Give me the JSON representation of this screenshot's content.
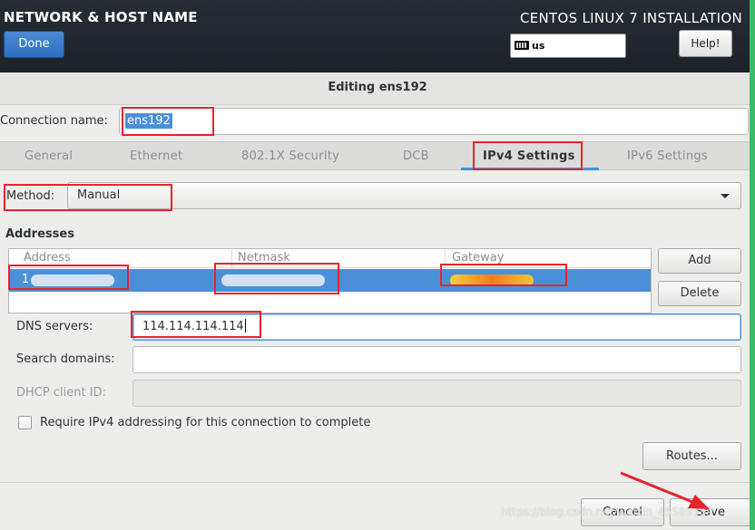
{
  "topbar": {
    "spoke_title": "NETWORK & HOST NAME",
    "done_label": "Done",
    "install_title": "CENTOS LINUX 7 INSTALLATION",
    "keyboard_layout": "us",
    "help_label": "Help!"
  },
  "dialog": {
    "title": "Editing ens192",
    "connection_name_label": "Connection name:",
    "connection_name_value": "ens192",
    "tabs": [
      {
        "label": "General",
        "active": false
      },
      {
        "label": "Ethernet",
        "active": false
      },
      {
        "label": "802.1X Security",
        "active": false
      },
      {
        "label": "DCB",
        "active": false
      },
      {
        "label": "IPv4 Settings",
        "active": true
      },
      {
        "label": "IPv6 Settings",
        "active": false
      }
    ],
    "method_label": "Method:",
    "method_value": "Manual",
    "addresses_title": "Addresses",
    "address_columns": [
      "Address",
      "Netmask",
      "Gateway"
    ],
    "address_row_first_char": "1",
    "add_label": "Add",
    "delete_label": "Delete",
    "dns_label": "DNS servers:",
    "dns_value": "114.114.114.114",
    "search_label": "Search domains:",
    "search_value": "",
    "dhcp_label": "DHCP client ID:",
    "dhcp_value": "",
    "require_label": "Require IPv4 addressing for this connection to complete",
    "require_checked": false,
    "routes_label": "Routes...",
    "cancel_label": "Cancel",
    "save_label": "Save"
  },
  "watermark": "https://blog.csdn.net/weixin_45589389",
  "colors": {
    "accent": "#4a90d9",
    "annotation_red": "#e8232b",
    "topbar": "#1f262b"
  },
  "icons": [
    "keyboard-icon",
    "dropdown-arrow-icon",
    "annotation-arrow"
  ]
}
